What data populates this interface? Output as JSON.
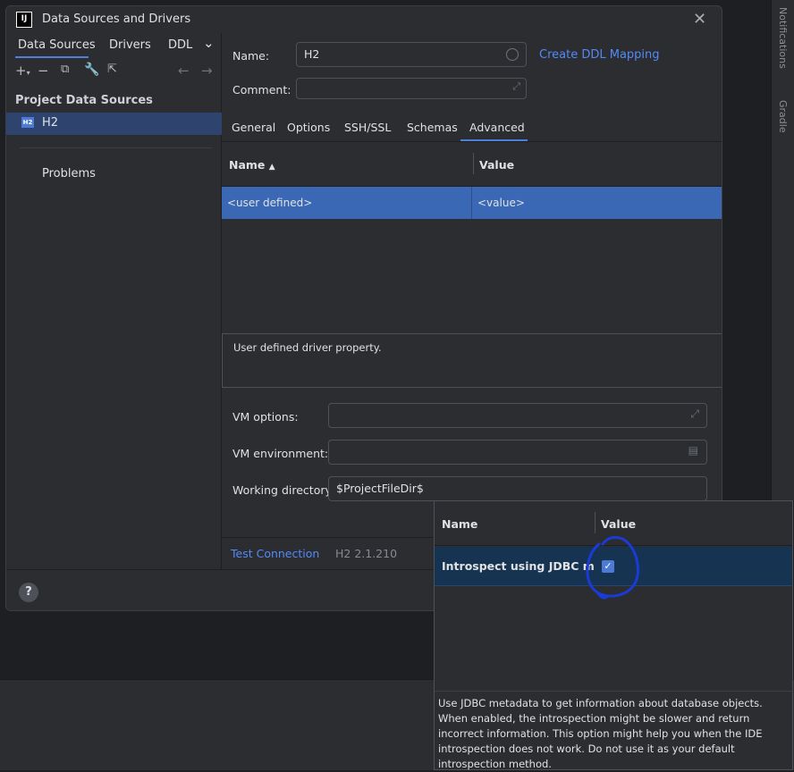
{
  "window": {
    "logo": "IJ",
    "title": "Data Sources and Drivers",
    "close": "✕"
  },
  "left": {
    "tabs": [
      "Data Sources",
      "Drivers",
      "DDL"
    ],
    "more": "⌄",
    "section_title": "Project Data Sources",
    "datasource": {
      "badge": "H2",
      "name": "H2"
    },
    "problems": "Problems"
  },
  "form": {
    "name_label": "Name:",
    "name_value": "H2",
    "create_ddl": "Create DDL Mapping",
    "comment_label": "Comment:",
    "comment_value": ""
  },
  "tabs": [
    "General",
    "Options",
    "SSH/SSL",
    "Schemas",
    "Advanced"
  ],
  "active_tab": "Advanced",
  "props": {
    "col_name": "Name",
    "col_value": "Value",
    "row": {
      "name": "<user defined>",
      "value": "<value>"
    },
    "description": "User defined driver property."
  },
  "vm": {
    "options_label": "VM options:",
    "options_value": "",
    "env_label": "VM environment:",
    "env_value": "",
    "wd_label": "Working directory:",
    "wd_value": "$ProjectFileDir$"
  },
  "footer": {
    "test_connection": "Test Connection",
    "driver_version": "H2 2.1.210"
  },
  "help": "?",
  "popup": {
    "col_name": "Name",
    "col_value": "Value",
    "row_name": "Introspect using JDBC metad",
    "checked": true,
    "description": "Use JDBC metadata to get information about database objects. When enabled, the introspection might be slower and return incorrect information. This option might help you when the IDE introspection does not work. Do not use it as your default introspection method."
  },
  "ide": {
    "side_labels": [
      "Notifications",
      "Gradle"
    ]
  },
  "colors": {
    "accent": "#4e80d9",
    "selection": "#3b68b5",
    "link": "#548af7",
    "annotation": "#1a3bd6"
  }
}
